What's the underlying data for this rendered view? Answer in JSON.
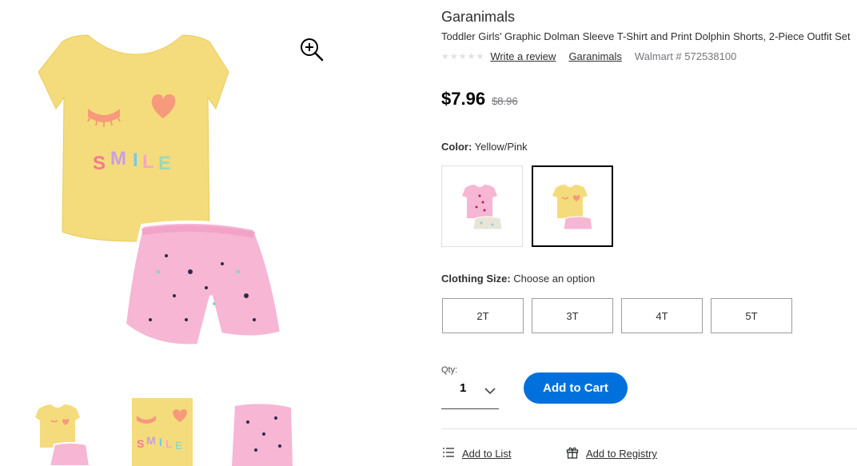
{
  "product": {
    "brand": "Garanimals",
    "title": "Toddler Girls' Graphic Dolman Sleeve T-Shirt and Print Dolphin Shorts, 2-Piece Outfit Set",
    "rating_stars": "★★★★★",
    "write_review": "Write a review",
    "brand_link": "Garanimals",
    "walmart_number": "Walmart # 572538100",
    "price": "$7.96",
    "was_price": "$8.96"
  },
  "color": {
    "label": "Color:",
    "value": "Yellow/Pink",
    "options": [
      "Pink",
      "Yellow/Pink"
    ],
    "selected_index": 1
  },
  "size": {
    "label": "Clothing Size:",
    "value": "Choose an option",
    "options": [
      "2T",
      "3T",
      "4T",
      "5T"
    ]
  },
  "quantity": {
    "label": "Qty:",
    "value": "1"
  },
  "actions": {
    "add_to_cart": "Add to Cart",
    "add_to_list": "Add to List",
    "add_to_registry": "Add to Registry"
  },
  "gallery": {
    "icons": {
      "zoom": "zoom-in-icon"
    },
    "thumbnail_count": 3,
    "shirt_print_text": "SMILE"
  },
  "colors": {
    "accent": "#0071dc",
    "shirt": "#f4dc7c",
    "shorts": "#f6b6d4",
    "heart": "#f79a7c"
  }
}
